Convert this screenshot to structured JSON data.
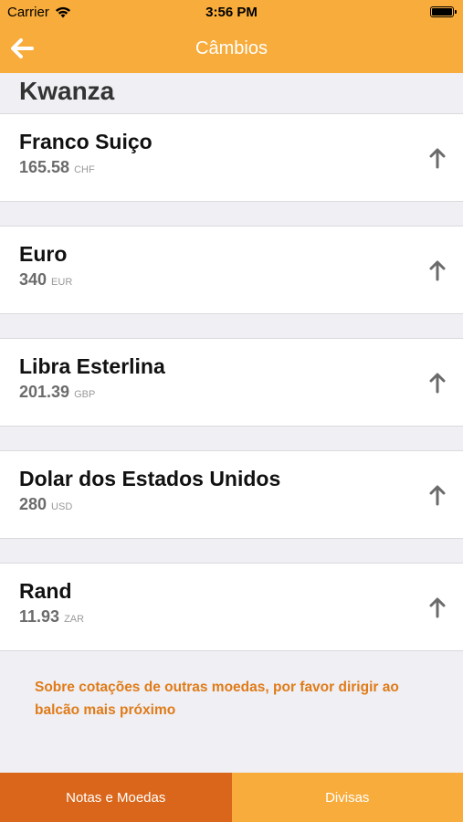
{
  "status_bar": {
    "carrier": "Carrier",
    "time": "3:56 PM"
  },
  "nav": {
    "title": "Câmbios"
  },
  "section": {
    "title": "Kwanza"
  },
  "rates": [
    {
      "name": "Franco Suiço",
      "value": "165.58",
      "code": "CHF"
    },
    {
      "name": "Euro",
      "value": "340",
      "code": "EUR"
    },
    {
      "name": "Libra Esterlina",
      "value": "201.39",
      "code": "GBP"
    },
    {
      "name": "Dolar dos Estados Unidos",
      "value": "280",
      "code": "USD"
    },
    {
      "name": "Rand",
      "value": "11.93",
      "code": "ZAR"
    }
  ],
  "footnote": "Sobre cotações de outras moedas, por favor dirigir ao balcão mais próximo",
  "tabs": {
    "notas": "Notas e Moedas",
    "divisas": "Divisas"
  },
  "colors": {
    "accent": "#f7ac3b",
    "active_tab": "#d9661a",
    "footnote_text": "#e07b18"
  }
}
